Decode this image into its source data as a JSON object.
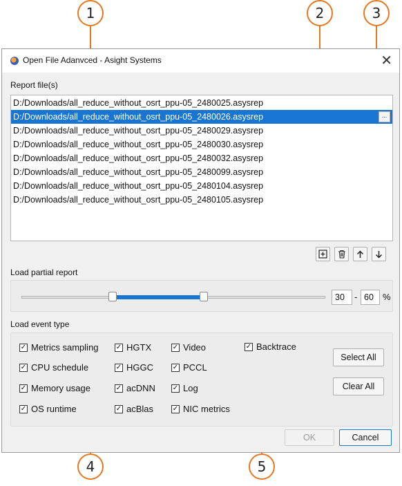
{
  "callouts": [
    "1",
    "2",
    "3",
    "4",
    "5"
  ],
  "window": {
    "title": "Open File Adanvced - Asight Systems",
    "close": "✕"
  },
  "report_files": {
    "label": "Report file(s)",
    "browse": "...",
    "selected_index": 1,
    "files": [
      "D:/Downloads/all_reduce_without_osrt_ppu-05_2480025.asysrep",
      "D:/Downloads/all_reduce_without_osrt_ppu-05_2480026.asysrep",
      "D:/Downloads/all_reduce_without_osrt_ppu-05_2480029.asysrep",
      "D:/Downloads/all_reduce_without_osrt_ppu-05_2480030.asysrep",
      "D:/Downloads/all_reduce_without_osrt_ppu-05_2480032.asysrep",
      "D:/Downloads/all_reduce_without_osrt_ppu-05_2480099.asysrep",
      "D:/Downloads/all_reduce_without_osrt_ppu-05_2480104.asysrep",
      "D:/Downloads/all_reduce_without_osrt_ppu-05_2480105.asysrep"
    ],
    "toolbar_icons": [
      "add-file-icon",
      "trash-icon",
      "arrow-up-icon",
      "arrow-down-icon"
    ]
  },
  "partial_report": {
    "label": "Load partial report",
    "from": "30",
    "separator": "-",
    "to": "60",
    "unit": "%",
    "range_fraction": [
      0.3,
      0.6
    ]
  },
  "event_type": {
    "label": "Load event type",
    "checkmark": "✓",
    "columns": [
      [
        "Metrics sampling",
        "CPU schedule",
        "Memory usage",
        "OS runtime"
      ],
      [
        "HGTX",
        "HGGC",
        "acDNN",
        "acBlas"
      ],
      [
        "Video",
        "PCCL",
        "Log",
        "NIC metrics"
      ],
      [
        "Backtrace"
      ]
    ],
    "select_all": "Select All",
    "clear_all": "Clear All"
  },
  "footer": {
    "ok": "OK",
    "cancel": "Cancel"
  },
  "colors": {
    "accent": "#e87722",
    "selection": "#1876d2"
  }
}
